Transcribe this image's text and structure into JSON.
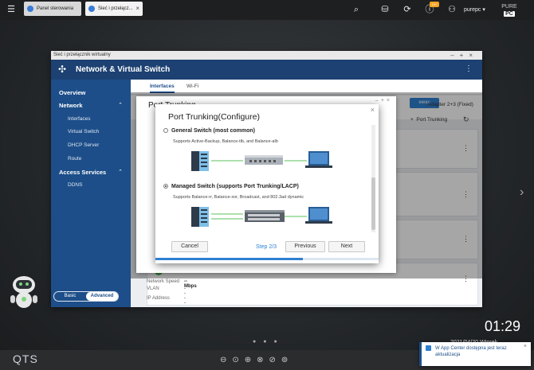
{
  "topbar": {
    "tabs": [
      {
        "label": "Panel sterowania"
      },
      {
        "label": "Sieć i przełącz..."
      }
    ],
    "notification_count": "10+",
    "user": "purepc ▾",
    "brand": {
      "line1": "PURE",
      "line2": "PC"
    }
  },
  "window": {
    "breadcrumb": "Sieć i przełącznik wirtualny",
    "title": "Network & Virtual Switch"
  },
  "sidebar": {
    "overview": "Overview",
    "network": "Network",
    "network_items": [
      "Interfaces",
      "Virtual Switch",
      "DHCP Server",
      "Route"
    ],
    "access_services": "Access Services",
    "access_items": [
      "DDNS"
    ],
    "mode_basic": "Basic",
    "mode_advanced": "Advanced"
  },
  "content": {
    "tabs": [
      "Interfaces",
      "Wi-Fi"
    ],
    "section_title": "Port Trunking",
    "gateway_label": "eway",
    "adapter_label": ": Adapter 2+3 (Fixed)",
    "add_port_trunking": "Port Trunking",
    "card_rows": [
      {
        "label": "IP Address",
        "value": "--"
      },
      {
        "label": "Network Speed",
        "value": "-- Mbps"
      },
      {
        "label": "VLAN",
        "value": "--"
      }
    ]
  },
  "behind_dialog": {
    "title": "Port Trunking"
  },
  "dialog": {
    "title": "Port Trunking(Configure)",
    "options": [
      {
        "label": "General Switch (most common)",
        "desc": "Supports Active-Backup, Balance-tlb, and Balance-alb",
        "selected": false
      },
      {
        "label": "Managed Switch (supports Port Trunking/LACP)",
        "desc": "Supports Balance-rr, Balance-xor, Broadcast, and 802.3ad dynamic",
        "selected": true
      }
    ],
    "cancel": "Cancel",
    "step": "Step 2/3",
    "previous": "Previous",
    "next": "Next",
    "progress_fraction": 0.66
  },
  "desktop": {
    "clock": "01:29",
    "date": "2021/04/20 Wtorek",
    "logo": "QTS",
    "notification": "W App Center dostępna jest teraz aktualizacja"
  },
  "colors": {
    "brand_blue": "#1d4e89",
    "accent": "#2f80d1"
  }
}
